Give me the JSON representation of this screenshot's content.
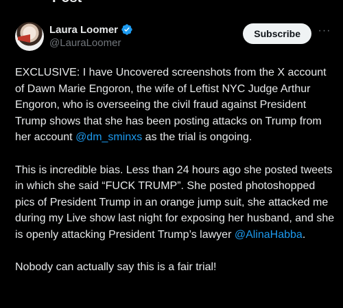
{
  "header": {
    "back_glyph": "←",
    "title": "Post"
  },
  "author": {
    "display_name": "Laura Loomer",
    "handle": "@LauraLoomer",
    "verified": true
  },
  "actions": {
    "subscribe_label": "Subscribe",
    "more_glyph": "···"
  },
  "post": {
    "paragraphs": [
      {
        "segments": [
          {
            "text": "EXCLUSIVE: I have Uncovered screenshots from the X account of Dawn Marie Engoron, the wife of Leftist NYC Judge Arthur Engoron, who is overseeing the civil fraud against President Trump shows that she has been posting attacks on Trump from her account ",
            "mention": false
          },
          {
            "text": "@dm_sminxs",
            "mention": true
          },
          {
            "text": " as the trial is ongoing.",
            "mention": false
          }
        ]
      },
      {
        "segments": [
          {
            "text": "This is incredible bias. Less than 24 hours ago she posted tweets in which she said “FUCK TRUMP”. She posted photoshopped pics of President Trump in an orange jump suit, she attacked me during my Live show last night for exposing her husband, and she is openly  attacking President Trump’s lawyer ",
            "mention": false
          },
          {
            "text": "@AlinaHabba",
            "mention": true
          },
          {
            "text": ".",
            "mention": false
          }
        ]
      },
      {
        "segments": [
          {
            "text": "Nobody can actually say this is a fair trial!",
            "mention": false
          }
        ]
      }
    ]
  },
  "colors": {
    "background": "#000000",
    "text": "#e7e9ea",
    "secondary_text": "#71767b",
    "link": "#1d9bf0",
    "verified_badge": "#1d9bf0",
    "subscribe_bg": "#eff3f4"
  }
}
